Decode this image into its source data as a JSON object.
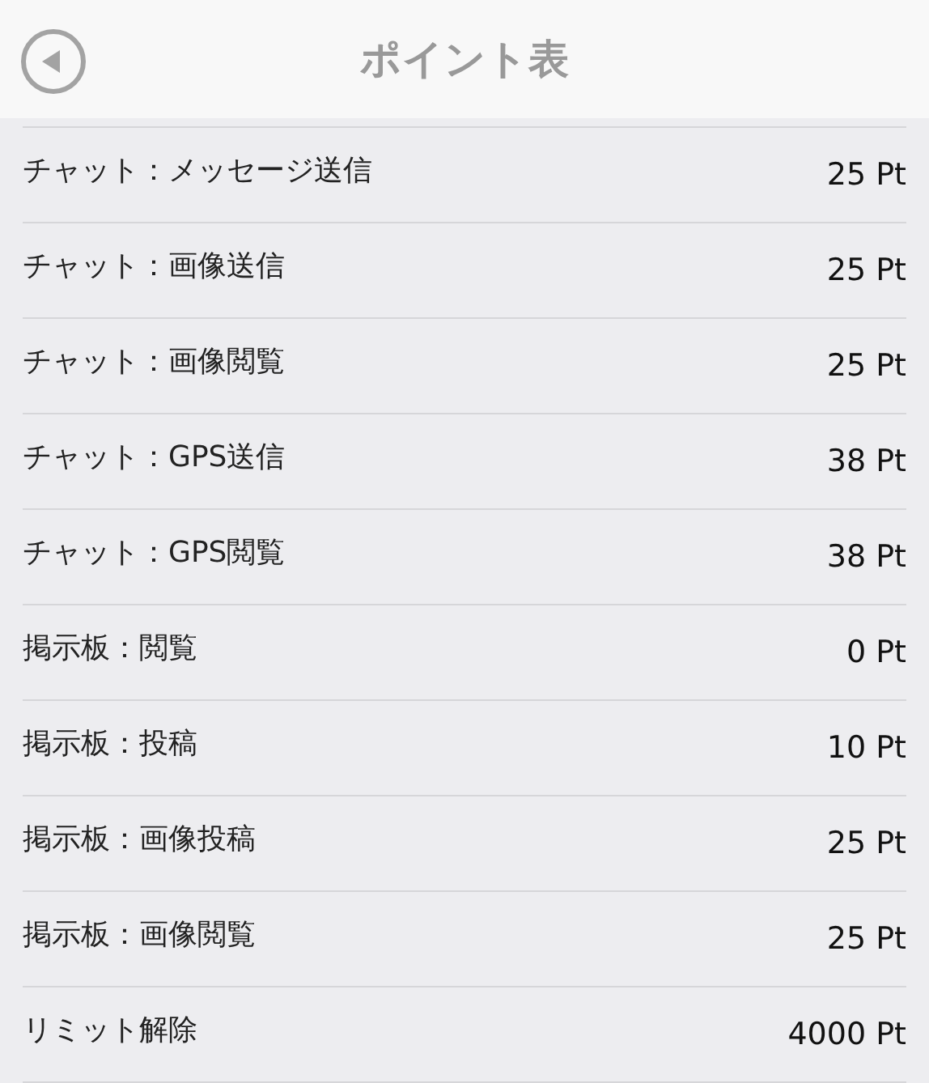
{
  "header": {
    "title": "ポイント表"
  },
  "rows": [
    {
      "label": "チャット：メッセージ送信",
      "value": "25 Pt"
    },
    {
      "label": "チャット：画像送信",
      "value": "25 Pt"
    },
    {
      "label": "チャット：画像閲覧",
      "value": "25 Pt"
    },
    {
      "label": "チャット：GPS送信",
      "value": "38 Pt"
    },
    {
      "label": "チャット：GPS閲覧",
      "value": "38 Pt"
    },
    {
      "label": "掲示板：閲覧",
      "value": "0 Pt"
    },
    {
      "label": "掲示板：投稿",
      "value": "10 Pt"
    },
    {
      "label": "掲示板：画像投稿",
      "value": "25 Pt"
    },
    {
      "label": "掲示板：画像閲覧",
      "value": "25 Pt"
    },
    {
      "label": "リミット解除",
      "value": "4000 Pt"
    }
  ]
}
